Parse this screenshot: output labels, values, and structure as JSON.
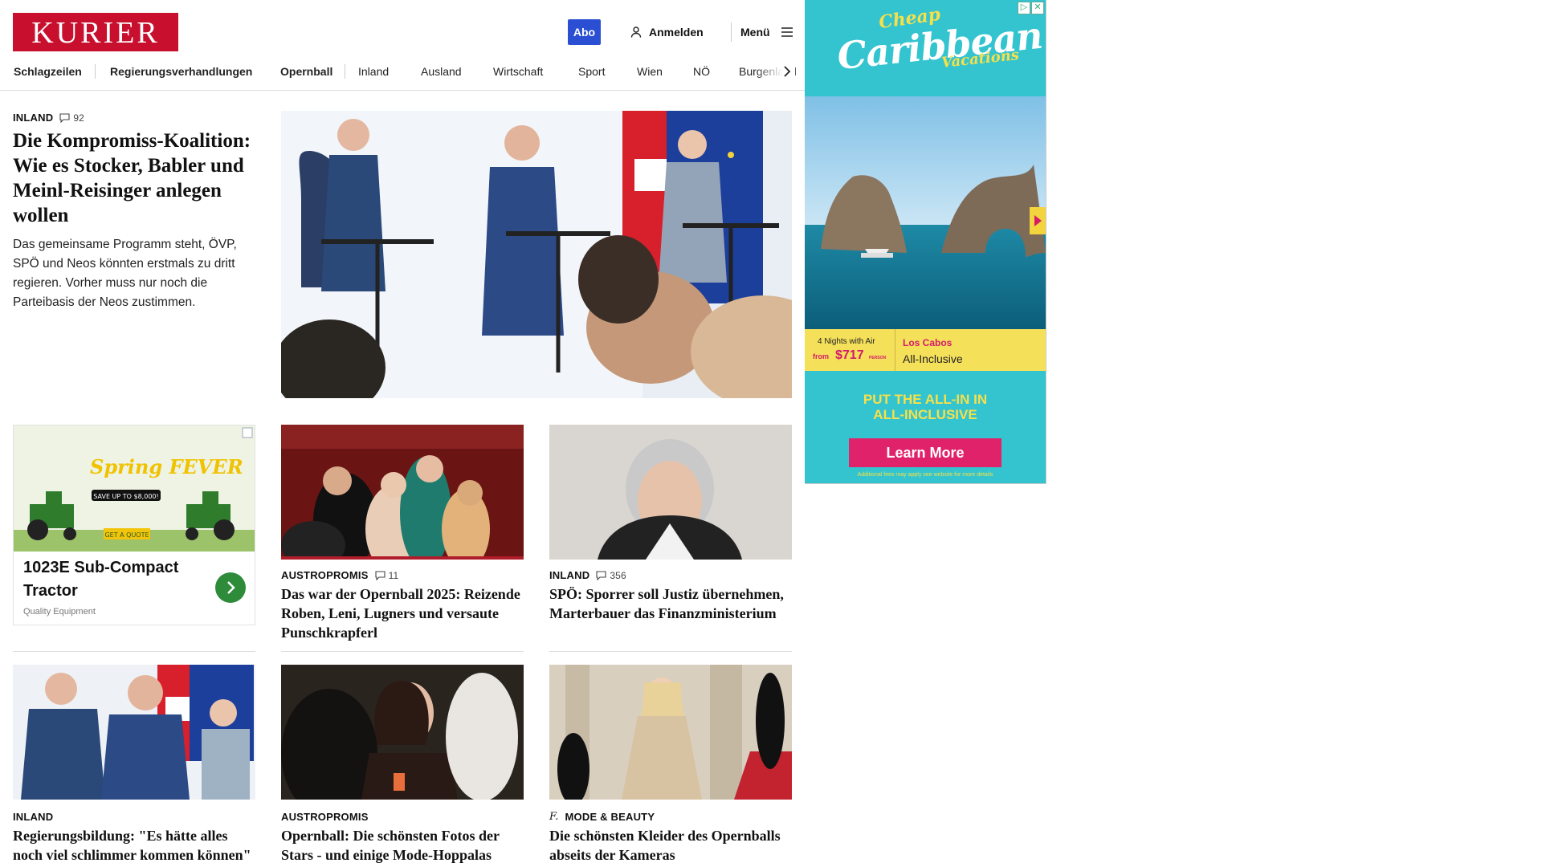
{
  "header": {
    "logo": "KURIER",
    "abo": "Abo",
    "login": "Anmelden",
    "menu": "Menü"
  },
  "nav": {
    "items": [
      "Schlagzeilen",
      "Regierungsverhandlungen",
      "Opernball",
      "Inland",
      "Ausland",
      "Wirtschaft",
      "Sport",
      "Wien",
      "NÖ",
      "Burgenland"
    ]
  },
  "lead": {
    "kicker": "INLAND",
    "comments": "92",
    "title": "Die Kompromiss-Koalition: Wie es Stocker, Babler und Meinl-Reisinger anlegen wollen",
    "teaser": "Das gemeinsame Programm steht, ÖVP, SPÖ und Neos könnten erstmals zu dritt regieren. Vorher muss nur noch die Parteibasis der Neos zustimmen."
  },
  "tractor_ad": {
    "title": "1023E Sub-Compact Tractor",
    "sub": "Quality Equipment",
    "creative_headline": "Spring FEVER",
    "creative_save": "SAVE UP TO $8,000!",
    "creative_cta": "GET A QUOTE"
  },
  "cards": [
    {
      "kicker": "AUSTROPROMIS",
      "comments": "11",
      "title": "Das war der Opernball 2025: Reizende Roben, Leni, Lugners und versaute Punschkrapferl"
    },
    {
      "kicker": "INLAND",
      "comments": "356",
      "title": "SPÖ: Sporrer soll Justiz übernehmen, Marterbauer das Finanzministerium"
    },
    {
      "kicker": "INLAND",
      "comments": "",
      "title": "Regierungsbildung: \"Es hätte alles noch viel schlimmer kommen können\""
    },
    {
      "kicker": "AUSTROPROMIS",
      "comments": "",
      "title": "Opernball: Die schönsten Fotos der Stars - und einige Mode-Hoppalas"
    },
    {
      "kicker": "MODE & BEAUTY",
      "comments": "",
      "title": "Die schönsten Kleider des Opernballs abseits der Kameras"
    }
  ],
  "sky_ad": {
    "cheap": "Cheap",
    "caribbean": "Caribbean",
    "vacations": "Vacations",
    "nights": "4 Nights with Air",
    "from": "from",
    "price": "$717",
    "person": "PERSON",
    "location": "Los Cabos",
    "inclusive": "All-Inclusive",
    "put_line1": "PUT THE ALL-IN IN",
    "put_line2": "ALL-INCLUSIVE",
    "cta": "Learn More",
    "fine": "Additional fees may apply see website for more details"
  },
  "colors": {
    "brand": "#c8102e",
    "abo": "#2b4fd3",
    "ad_teal": "#33c4cf",
    "ad_yellow": "#f5e05a",
    "ad_pink": "#e0226b"
  }
}
